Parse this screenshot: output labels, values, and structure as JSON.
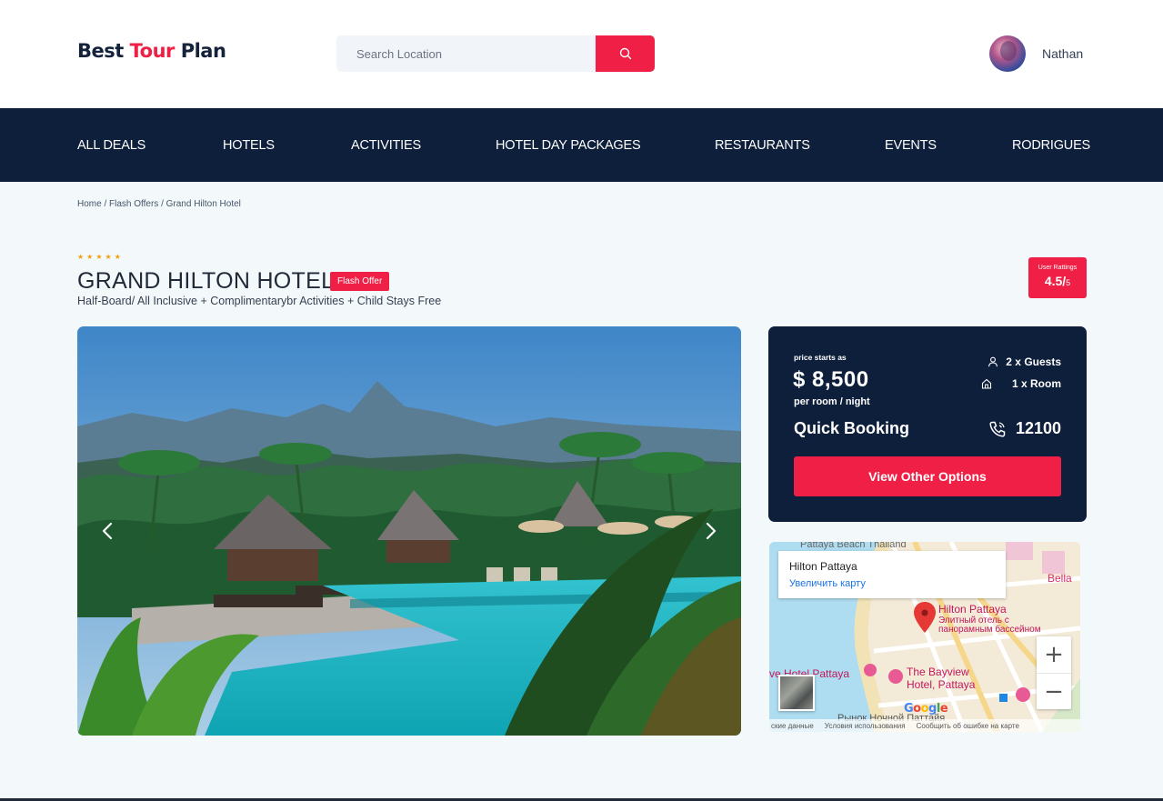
{
  "header": {
    "logo_part1": "Best",
    "logo_part2": "Tour",
    "logo_part3": "Plan",
    "search_placeholder": "Search Location",
    "user_name": "Nathan"
  },
  "nav": {
    "items": [
      "ALL DEALS",
      "HOTELS",
      "ACTIVITIES",
      "HOTEL DAY PACKAGES",
      "RESTAURANTS",
      "EVENTS",
      "RODRIGUES"
    ]
  },
  "breadcrumb": "Home / Flash Offers / Grand Hilton Hotel",
  "hotel": {
    "stars": 5,
    "stars_text": "★★★★★",
    "title": "GRAND HILTON HOTEL",
    "badge": "Flash Offer",
    "subtitle": "Half-Board/ All Inclusive + Complimentarybr Activities + Child Stays Free",
    "rating_label": "User Rattings",
    "rating_value": "4.5/",
    "rating_max": "5"
  },
  "booking": {
    "price_label": "price starts as",
    "price": "$ 8,500",
    "per": "per room / night",
    "guests": "2 x Guests",
    "rooms": "1 x Room",
    "quick": "Quick Booking",
    "phone": "12100",
    "cta": "View Other Options"
  },
  "map": {
    "card_title": "Hilton Pattaya",
    "card_link": "Увеличить карту",
    "top_label": "Pattaya Beach Thailand",
    "right_label": "Bella",
    "pin_title": "Hilton Pattaya",
    "pin_desc_1": "Элитный отель с",
    "pin_desc_2": "панорамным бассейном",
    "place_1": "The Bayview",
    "place_2": "Hotel, Pattaya",
    "place_3": "ve Hotel Pattaya",
    "place_4": "Рынок Ночной Паттайя",
    "google": "Google",
    "attr_1": "ские данные",
    "attr_2": "Условия использования",
    "attr_3": "Сообщить об ошибке на карте",
    "zoom_in": "+",
    "zoom_out": "−"
  },
  "colors": {
    "accent": "#ef1f45",
    "navy": "#0e1f3b",
    "star": "#f59e0b"
  }
}
